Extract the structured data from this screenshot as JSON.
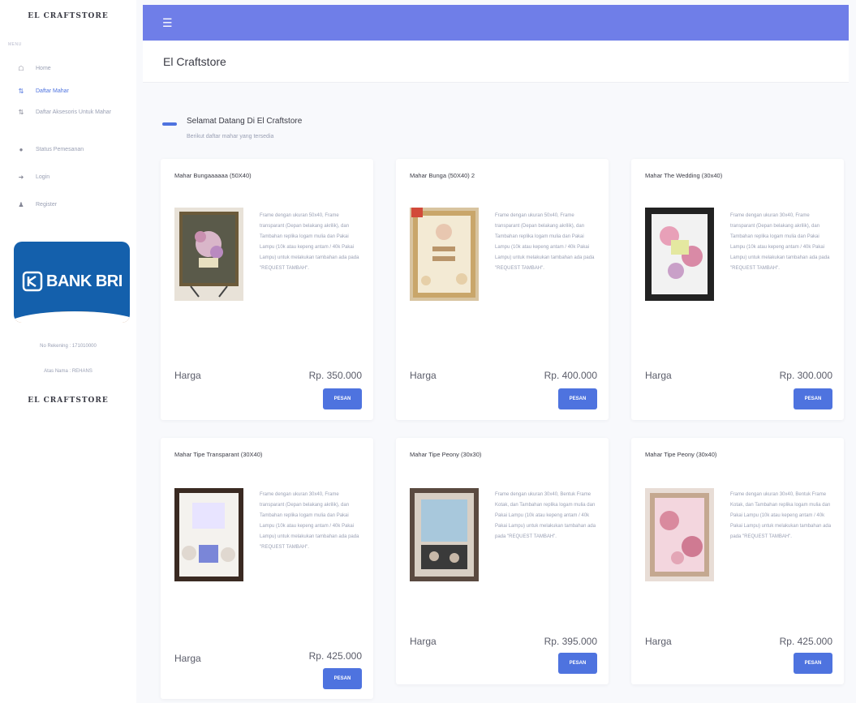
{
  "sidebar": {
    "brand": "EL CRAFTSTORE",
    "menu_heading": "MENU",
    "items": [
      {
        "label": "Home",
        "icon": "home-icon"
      },
      {
        "label": "Daftar Mahar",
        "icon": "list-icon"
      },
      {
        "label": "Daftar Aksesoris Untuk Mahar",
        "icon": "list-icon"
      },
      {
        "label": "Status Pemesanan",
        "icon": "status-icon"
      },
      {
        "label": "Login",
        "icon": "login-icon"
      },
      {
        "label": "Register",
        "icon": "user-icon"
      }
    ],
    "bank_logo_text": "BANK BRI",
    "no_rekening": "No Rekening : 171010000",
    "atas_nama": "Atas Nama : REHANS",
    "brand_footer": "EL CRAFTSTORE"
  },
  "topbar": {
    "menu_icon": "hamburger-icon",
    "color": "#6f7ee8"
  },
  "page": {
    "title": "El Craftstore"
  },
  "welcome": {
    "title": "Selamat Datang Di El Craftstore",
    "subtitle": "Berikut daftar mahar yang tersedia"
  },
  "products": [
    {
      "title": "Mahar Bungaaaaaa (50X40)",
      "desc": "Frame dengan ukuran 50x40, Frame transparant (Depan belakang akrilik), dan Tambahan replika logam mulia dan Pakai Lampu (10k atau kepeng antam / 40k Pakai Lampu) untuk melakukan tambahan ada pada \"REQUEST TAMBAH\".",
      "harga_label": "Harga",
      "price": "Rp. 350.000",
      "button": "PESAN"
    },
    {
      "title": "Mahar Bunga (50X40) 2",
      "desc": "Frame dengan ukuran 50x40, Frame transparant (Depan belakang akrilik), dan Tambahan replika logam mulia dan Pakai Lampu (10k atau kepeng antam / 40k Pakai Lampu) untuk melakukan tambahan ada pada \"REQUEST TAMBAH\".",
      "harga_label": "Harga",
      "price": "Rp. 400.000",
      "button": "PESAN"
    },
    {
      "title": "Mahar The Wedding (30x40)",
      "desc": "Frame dengan ukuran 30x40, Frame transparant (Depan belakang akrilik), dan Tambahan replika logam mulia dan Pakai Lampu (10k atau kepeng antam / 40k Pakai Lampu) untuk melakukan tambahan ada pada \"REQUEST TAMBAH\".",
      "harga_label": "Harga",
      "price": "Rp. 300.000",
      "button": "PESAN"
    },
    {
      "title": "Mahar Tipe Transparant (30X40)",
      "desc": "Frame dengan ukuran 30x40, Frame transparant (Depan belakang akrilik), dan Tambahan replika logam mulia dan Pakai Lampu (10k atau kepeng antam / 40k Pakai Lampu) untuk melakukan tambahan ada pada \"REQUEST TAMBAH\".",
      "harga_label": "Harga",
      "price": "Rp. 425.000",
      "button": "PESAN"
    },
    {
      "title": "Mahar Tipe Peony (30x30)",
      "desc": "Frame dengan ukuran 30x40, Bentuk Frame Kotak, dan Tambahan replika logam mulia dan Pakai Lampu (10k atau kepeng antam / 40k Pakai Lampu) untuk melakukan tambahan ada pada \"REQUEST TAMBAH\".",
      "harga_label": "Harga",
      "price": "Rp. 395.000",
      "button": "PESAN"
    },
    {
      "title": "Mahar Tipe Peony (30x40)",
      "desc": "Frame dengan ukuran 30x40, Bentuk Frame Kotak, dan Tambahan replika logam mulia dan Pakai Lampu (10k atau kepeng antam / 40k Pakai Lampu) untuk melakukan tambahan ada pada \"REQUEST TAMBAH\".",
      "harga_label": "Harga",
      "price": "Rp. 425.000",
      "button": "PESAN"
    }
  ]
}
